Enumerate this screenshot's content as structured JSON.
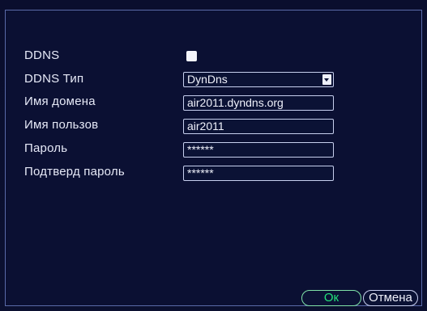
{
  "ddns": {
    "enabled_label": "DDNS",
    "enabled": false,
    "type_label": "DDNS Тип",
    "type_value": "DynDns",
    "domain_label": "Имя домена",
    "domain_value": "air2011.dyndns.org",
    "user_label": "Имя пользов",
    "user_value": "air2011",
    "password_label": "Пароль",
    "password_value": "******",
    "confirm_label": "Подтверд пароль",
    "confirm_value": "******"
  },
  "buttons": {
    "ok_label": "Ок",
    "cancel_label": "Отмена"
  },
  "colors": {
    "background": "#0b1033",
    "ok_accent": "#22e27a"
  }
}
